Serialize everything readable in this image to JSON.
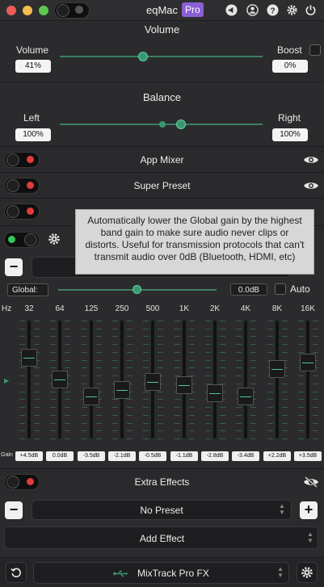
{
  "app": {
    "title": "eqMac",
    "badge": "Pro"
  },
  "colors": {
    "accent": "#3a9871",
    "close": "#ec5e57",
    "minimize": "#f4be4f",
    "zoom": "#5ec751",
    "toggle_off": "#e03c3c",
    "toggle_on": "#34c759"
  },
  "header_icons": [
    "megaphone-icon",
    "user-icon",
    "help-icon",
    "settings-icon",
    "power-icon"
  ],
  "volume": {
    "title": "Volume",
    "left_label": "Volume",
    "left_value": "41%",
    "right_label": "Boost",
    "right_value": "0%",
    "level": 0.41
  },
  "balance": {
    "title": "Balance",
    "left_label": "Left",
    "left_value": "100%",
    "right_label": "Right",
    "right_value": "100%"
  },
  "rows": {
    "app_mixer": "App Mixer",
    "super_preset": "Super Preset"
  },
  "tooltip": "Automatically lower the Global gain by the highest band gain to make sure audio never clips or distorts. Useful for transmission protocols that can't transmit audio over 0dB (Bluetooth, HDMI, etc)",
  "eq": {
    "global_label": "Global:",
    "global_value": "0.0dB",
    "auto_label": "Auto",
    "hz_label": "Hz",
    "gain_label": "Gain",
    "bands": [
      {
        "freq": "32",
        "gain": "+4.5dB",
        "db": 4.5
      },
      {
        "freq": "64",
        "gain": "0.0dB",
        "db": 0.0
      },
      {
        "freq": "125",
        "gain": "-3.5dB",
        "db": -3.5
      },
      {
        "freq": "250",
        "gain": "-2.1dB",
        "db": -2.1
      },
      {
        "freq": "500",
        "gain": "-0.5dB",
        "db": -0.5
      },
      {
        "freq": "1K",
        "gain": "-1.1dB",
        "db": -1.1
      },
      {
        "freq": "2K",
        "gain": "-2.8dB",
        "db": -2.8
      },
      {
        "freq": "4K",
        "gain": "-3.4dB",
        "db": -3.4
      },
      {
        "freq": "8K",
        "gain": "+2.2dB",
        "db": 2.2
      },
      {
        "freq": "16K",
        "gain": "+3.5dB",
        "db": 3.5
      }
    ]
  },
  "extra_effects": {
    "title": "Extra Effects",
    "preset": "No Preset",
    "add_effect": "Add Effect"
  },
  "output": {
    "device": "MixTrack Pro FX"
  }
}
